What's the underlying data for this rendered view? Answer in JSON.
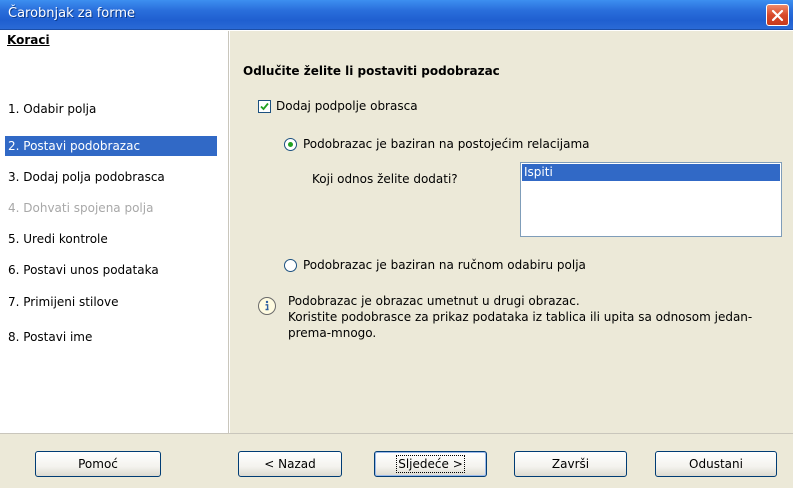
{
  "window": {
    "title": "Čarobnjak za forme"
  },
  "sidebar": {
    "heading": "Koraci",
    "steps": [
      {
        "label": "1. Odabir polja",
        "state": "normal"
      },
      {
        "label": "2. Postavi podobrazac",
        "state": "active"
      },
      {
        "label": "3. Dodaj polja podobrasca",
        "state": "normal"
      },
      {
        "label": "4. Dohvati spojena polja",
        "state": "disabled"
      },
      {
        "label": "5. Uredi kontrole",
        "state": "normal"
      },
      {
        "label": "6. Postavi unos podataka",
        "state": "normal"
      },
      {
        "label": "7. Primijeni stilove",
        "state": "normal"
      },
      {
        "label": "8. Postavi ime",
        "state": "normal"
      }
    ]
  },
  "main": {
    "heading": "Odlučite želite li postaviti podobrazac",
    "add_subform_checkbox": {
      "label": "Dodaj podpolje obrasca",
      "checked": true
    },
    "radio_relation": {
      "label": "Podobrazac je baziran na postojećim relacijama",
      "selected": true
    },
    "relation_question": "Koji odnos želite dodati?",
    "relation_list": [
      "Ispiti"
    ],
    "radio_manual": {
      "label": "Podobrazac je baziran na ručnom odabiru polja",
      "selected": false
    },
    "info": {
      "line1": "Podobrazac je obrazac umetnut u drugi obrazac.",
      "line2": "Koristite podobrasce za prikaz podataka iz tablica ili upita sa odnosom jedan-",
      "line3": "prema-mnogo."
    }
  },
  "footer": {
    "help": "Pomoć",
    "back": "< Nazad",
    "next": "Sljedeće >",
    "finish": "Završi",
    "cancel": "Odustani"
  },
  "colors": {
    "selection": "#3169c6",
    "titlebar": "#2a6fdc",
    "panel": "#ece9d8"
  }
}
